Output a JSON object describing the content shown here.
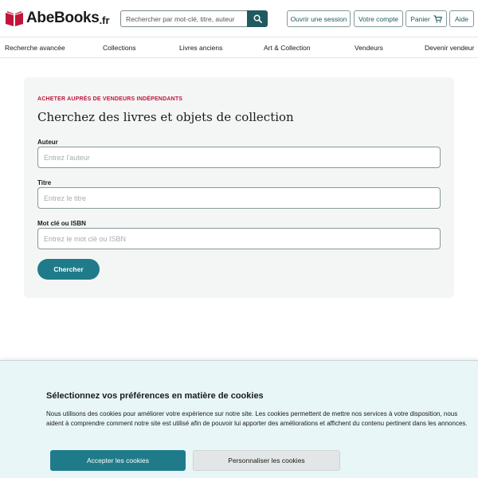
{
  "header": {
    "logo_name": "AbeBooks",
    "logo_tld": ".fr",
    "search_placeholder": "Rechercher par mot-clé, titre, auteur",
    "sign_in": "Ouvrir une session",
    "account": "Votre compte",
    "cart": "Panier",
    "help": "Aide",
    "icons": [
      "search-icon",
      "cart-icon",
      "book-logo-icon"
    ],
    "brand_color": "#c0153a",
    "accent_color": "#1f5a61"
  },
  "nav": {
    "items": [
      "Recherche avancée",
      "Collections",
      "Livres anciens",
      "Art & Collection",
      "Vendeurs",
      "Devenir vendeur"
    ]
  },
  "search_card": {
    "eyebrow": "ACHETER AUPRÈS DE VENDEURS INDÉPENDANTS",
    "title": "Cherchez des livres et objets de collection",
    "author_label": "Auteur",
    "author_placeholder": "Entrez l'auteur",
    "title_label": "Titre",
    "title_placeholder": "Entrez le titre",
    "keyword_label": "Mot clé ou ISBN",
    "keyword_placeholder": "Entrez le mot clé ou ISBN",
    "submit": "Chercher"
  },
  "cookie_banner": {
    "title": "Sélectionnez vos préférences en matière de cookies",
    "text": "Nous utilisons des cookies pour améliorer votre expérience sur notre site. Les cookies permettent de mettre nos services à votre disposition, nous aident à comprendre comment notre site est utilisé afin de pouvoir lui apporter des améliorations et affichent du contenu pertinent dans les annonces.",
    "accept": "Accepter les cookies",
    "customize": "Personnaliser les cookies"
  }
}
